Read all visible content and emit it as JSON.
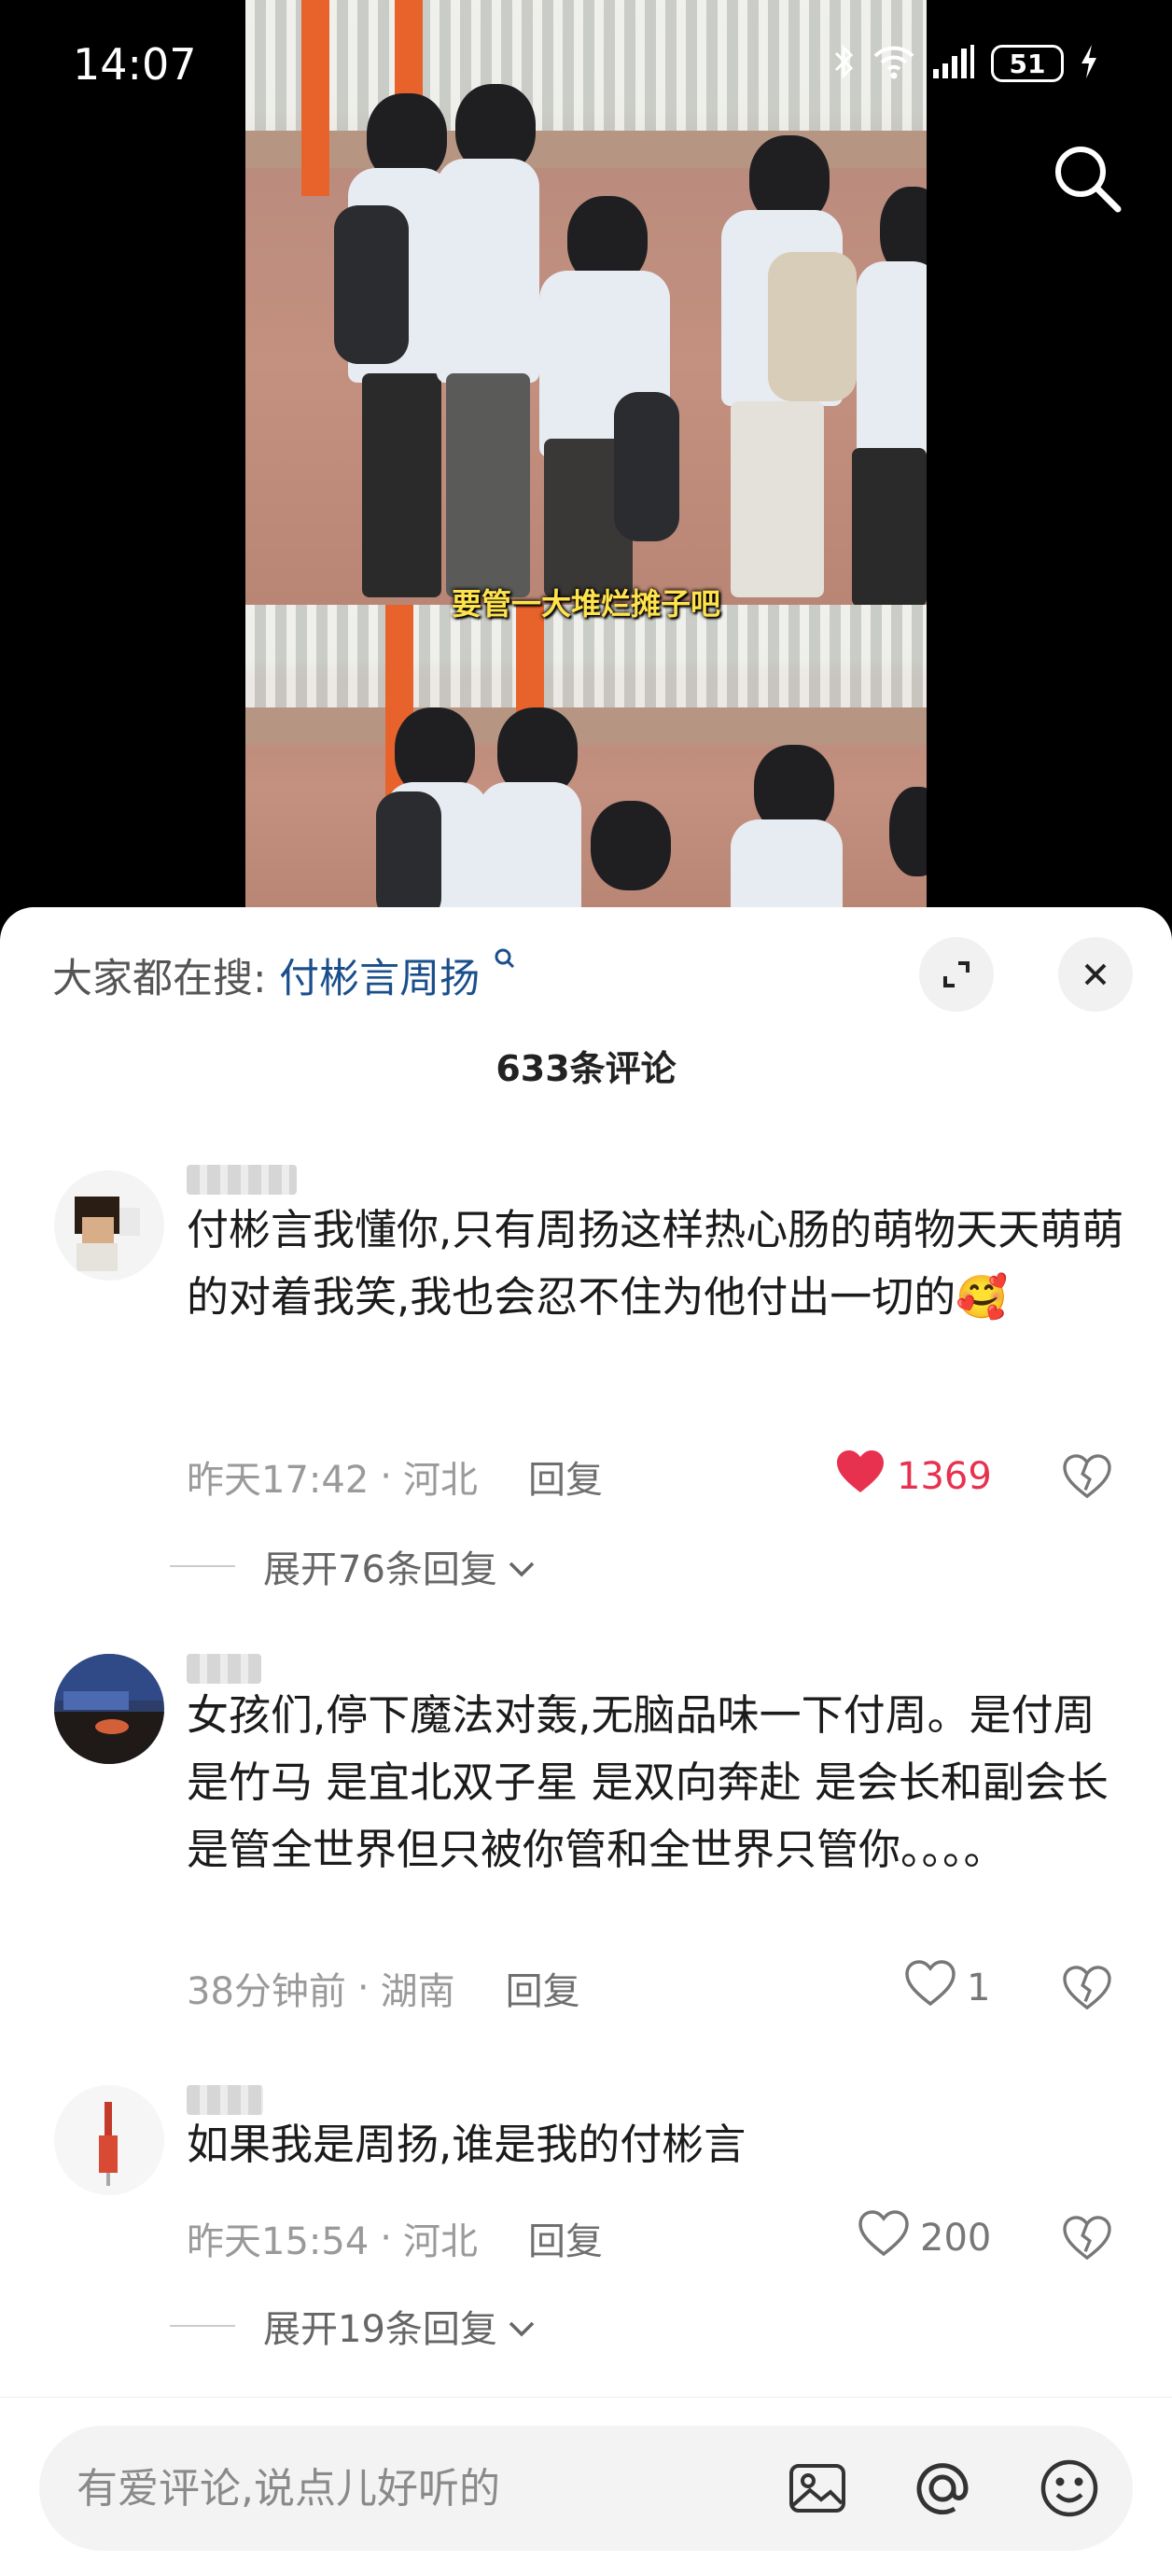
{
  "status_bar": {
    "time": "14:07",
    "battery": "51"
  },
  "video": {
    "subtitle": "要管一大堆烂摊子吧"
  },
  "panel": {
    "search_prefix": "大家都在搜:",
    "search_keyword": "付彬言周扬",
    "comment_count": "633条评论"
  },
  "comments": [
    {
      "text": "付彬言我懂你,只有周扬这样热心肠的萌物天天萌萌的对着我笑,我也会忍不住为他付出一切的🥰",
      "time": "昨天17:42",
      "location": "河北",
      "reply_label": "回复",
      "likes": "1369",
      "liked": true,
      "expand_label": "展开76条回复"
    },
    {
      "text": "女孩们,停下魔法对轰,无脑品味一下付周。是付周 是竹马 是宜北双子星 是双向奔赴 是会长和副会长 是管全世界但只被你管和全世界只管你。。。。",
      "time": "38分钟前",
      "location": "湖南",
      "reply_label": "回复",
      "likes": "1",
      "liked": false
    },
    {
      "text": "如果我是周扬,谁是我的付彬言",
      "time": "昨天15:54",
      "location": "河北",
      "reply_label": "回复",
      "likes": "200",
      "liked": false,
      "expand_label": "展开19条回复"
    }
  ],
  "input": {
    "placeholder": "有爱评论,说点儿好听的"
  },
  "icons": {
    "search": "search-icon",
    "close": "close-icon",
    "expand": "expand-icon",
    "like": "heart-icon",
    "dislike": "broken-heart-icon",
    "image": "image-icon",
    "mention": "at-icon",
    "emoji": "emoji-icon"
  },
  "colors": {
    "liked": "#e8314f",
    "keyword": "#1a4f8b",
    "subtitle": "#ffe34d"
  }
}
